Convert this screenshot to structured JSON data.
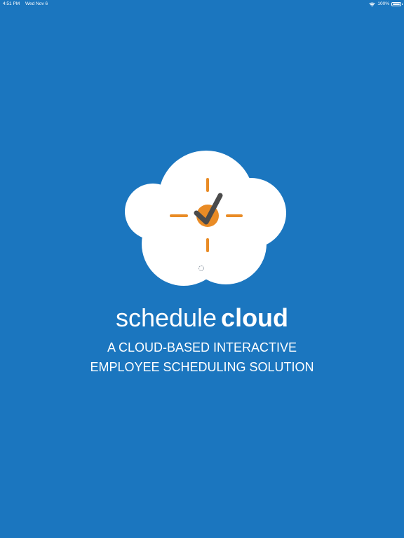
{
  "status_bar": {
    "time": "4:51 PM",
    "date": "Wed Nov 6",
    "battery": "100%",
    "battery_level": 1.0,
    "icons": [
      "wifi-icon",
      "battery-icon"
    ]
  },
  "splash": {
    "brand_light": "schedule",
    "brand_bold": "cloud",
    "tagline_line1": "A CLOUD-BASED INTERACTIVE",
    "tagline_line2": "EMPLOYEE SCHEDULING SOLUTION",
    "logo_icon": "cloud-clock-check-logo",
    "loading_indicator": "spinner-icon"
  },
  "colors": {
    "background": "#1b76bf",
    "cloud": "#ffffff",
    "accent": "#e98b25",
    "check": "#4b4b4b",
    "text": "#ffffff"
  }
}
